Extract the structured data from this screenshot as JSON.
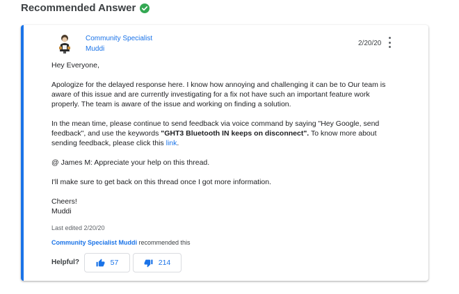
{
  "heading": {
    "title": "Recommended Answer"
  },
  "author": {
    "role": "Community Specialist",
    "name": "Muddi"
  },
  "post": {
    "date": "2/20/20",
    "greeting": "Hey Everyone,",
    "para1": "Apologize for the delayed response here. I know how annoying and challenging it can be to  Our team is aware of this issue and are currently investigating for a fix not have such an important feature work properly. The team is aware of the issue and working on finding a solution.",
    "para2_before": "In the mean time, please continue to send feedback via voice command by saying \"Hey Google, send feedback\", and use the keywords ",
    "para2_bold": "\"GHT3 Bluetooth IN keeps on disconnect\".",
    "para2_after": " To know more about sending feedback, please click this ",
    "para2_link": "link",
    "para2_end": ".",
    "para3": "@ James M: Appreciate your help on this thread.",
    "para4": "I'll make sure to get back on this thread once I got more information.",
    "signoff": "Cheers!",
    "signature": "Muddi"
  },
  "meta": {
    "last_edited": "Last edited 2/20/20",
    "recommended_by": "Community Specialist Muddi",
    "recommended_suffix": " recommended this"
  },
  "feedback": {
    "label": "Helpful?",
    "upvotes": "57",
    "downvotes": "214"
  },
  "colors": {
    "accent": "#1a73e8",
    "check": "#34a853"
  }
}
